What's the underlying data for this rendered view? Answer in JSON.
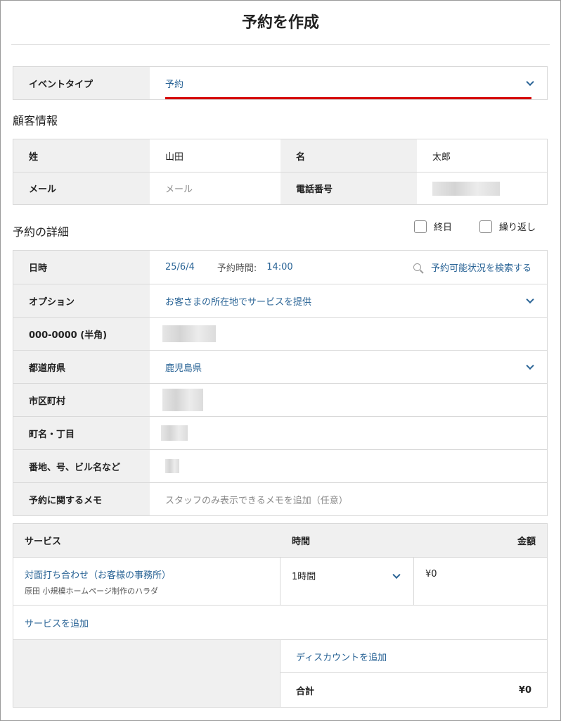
{
  "header": {
    "title": "予約を作成"
  },
  "event_type": {
    "label": "イベントタイプ",
    "value": "予約",
    "accent": "#d40000"
  },
  "customer": {
    "heading": "顧客情報",
    "last_name_label": "姓",
    "last_name_value": "山田",
    "first_name_label": "名",
    "first_name_value": "太郎",
    "email_label": "メール",
    "email_placeholder": "メール",
    "phone_label": "電話番号"
  },
  "details": {
    "heading": "予約の詳細",
    "all_day_label": "終日",
    "repeat_label": "繰り返し",
    "datetime_label": "日時",
    "date_value": "25/6/4",
    "time_label": "予約時間:",
    "time_value": "14:00",
    "search_link": "予約可能状況を検索する",
    "option_label": "オプション",
    "option_value": "お客さまの所在地でサービスを提供",
    "postal_label": "000-0000 (半角)",
    "prefecture_label": "都道府県",
    "prefecture_value": "鹿児島県",
    "city_label": "市区町村",
    "town_label": "町名・丁目",
    "address_label": "番地、号、ビル名など",
    "memo_label": "予約に関するメモ",
    "memo_placeholder": "スタッフのみ表示できるメモを追加（任意）"
  },
  "services": {
    "col_service": "サービス",
    "col_time": "時間",
    "col_price": "金額",
    "items": [
      {
        "name": "対面打ち合わせ（お客様の事務所）",
        "staff": "原田 小規模ホームページ制作のハラダ",
        "duration": "1時間",
        "price": "¥0"
      }
    ],
    "add_service": "サービスを追加",
    "add_discount": "ディスカウントを追加",
    "total_label": "合計",
    "total_value": "¥0"
  },
  "colors": {
    "link": "#2a6496",
    "label_bg": "#f0f0f0",
    "border": "#d9d9d9"
  }
}
